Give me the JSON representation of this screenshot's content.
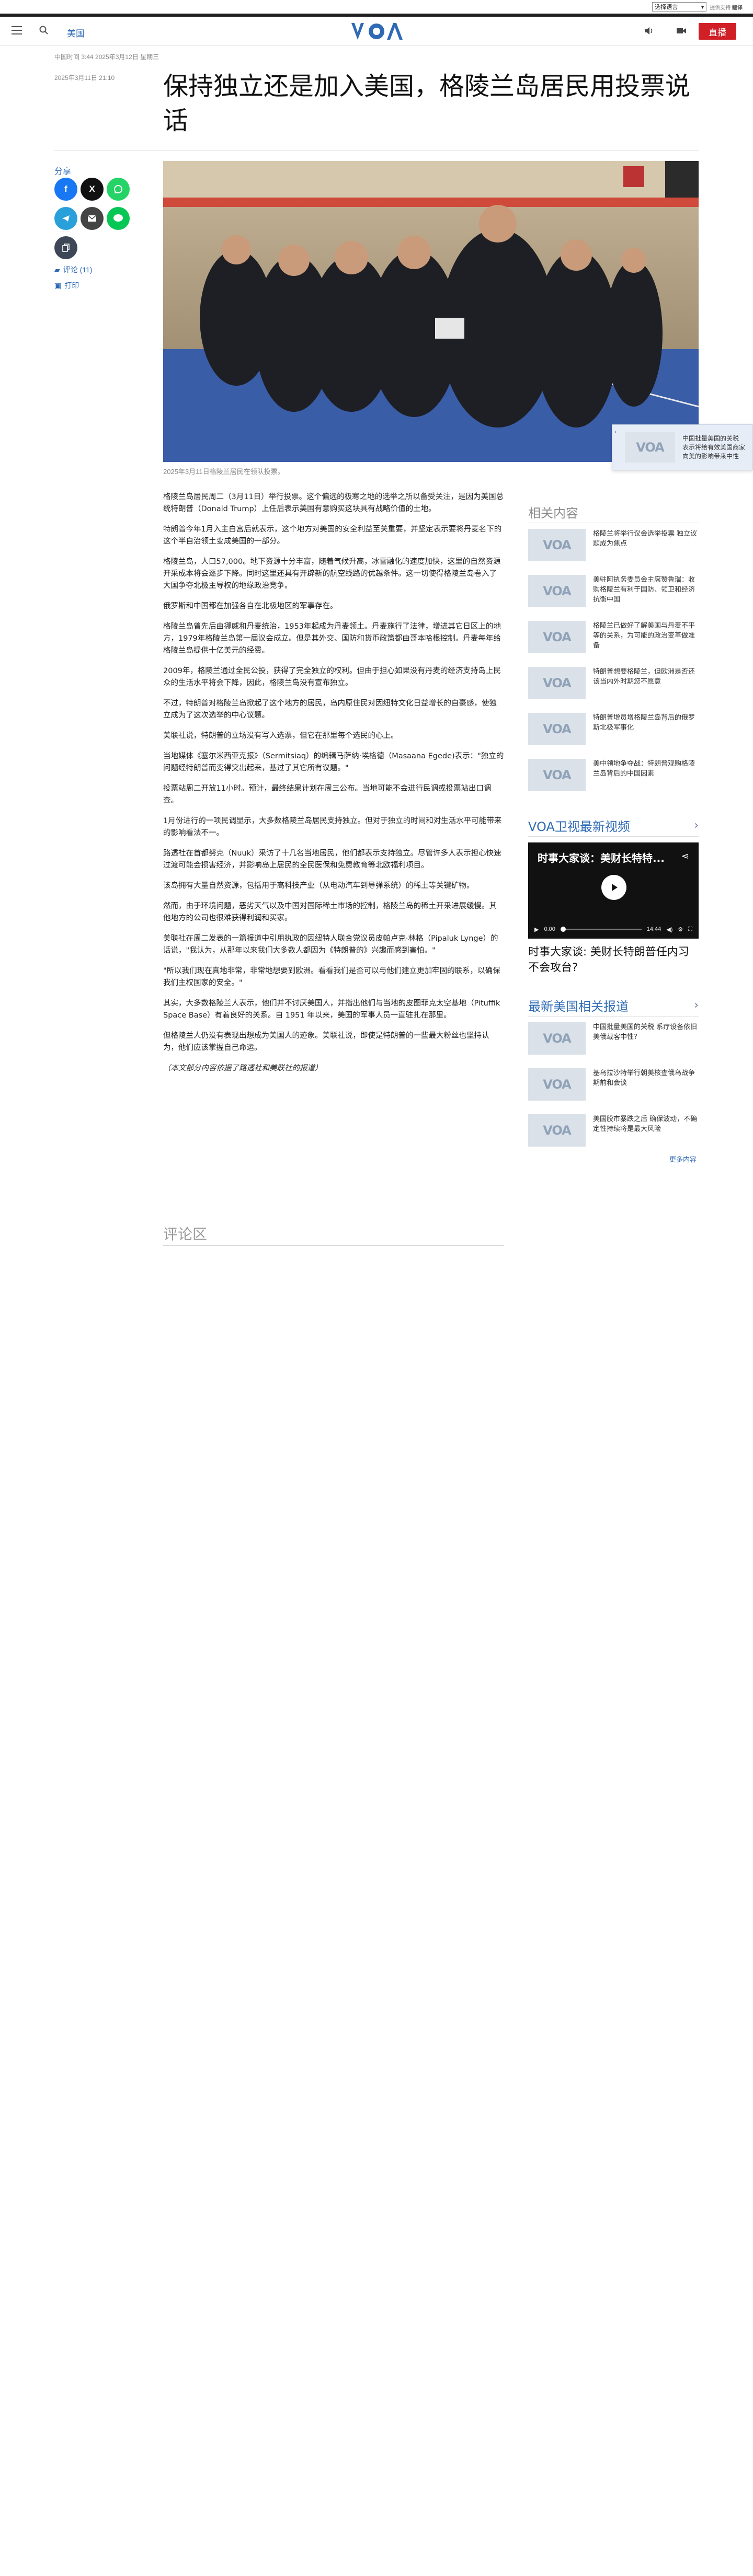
{
  "translate": {
    "select_label": "选择语言",
    "powered_prefix": "提供支持",
    "powered_brand": "翻译"
  },
  "header": {
    "section": "美国",
    "live_label": "直播"
  },
  "meta": {
    "timeline": "中国时间 3:44 2025年3月12日 星期三",
    "date": "2025年3月11日 21:10"
  },
  "article": {
    "title": "保持独立还是加入美国，格陵兰岛居民用投票说话",
    "caption": "2025年3月11日格陵兰居民在领队投票。",
    "paragraphs": [
      "格陵兰岛居民周二（3月11日）举行投票。这个偏远的极寒之地的选举之所以备受关注，是因为美国总统特朗普（Donald Trump）上任后表示美国有意购买这块具有战略价值的土地。",
      "特朗普今年1月入主白宫后就表示，这个地方对美国的安全利益至关重要，并坚定表示要将丹麦名下的这个半自治领土变成美国的一部分。",
      "格陵兰岛，人口57,000。地下资源十分丰富，随着气候升高，冰雪融化的速度加快，这里的自然资源开采成本将会逐步下降。同时这里还具有开辟新的航空线路的优越条件。这一切使得格陵兰岛卷入了大国争夺北极主导权的地缘政治竞争。",
      "俄罗斯和中国都在加强各自在北极地区的军事存在。",
      "格陵兰岛曾先后由挪威和丹麦统治，1953年起成为丹麦领土。丹麦施行了法律，增进其它日区上的地方，1979年格陵兰岛第一届议会成立。但是其外交、国防和货币政策都由哥本哈根控制。丹麦每年给格陵兰岛提供十亿美元的经费。",
      "2009年，格陵兰通过全民公投，获得了完全独立的权利。但由于担心如果没有丹麦的经济支持岛上民众的生活水平将会下降，因此，格陵兰岛没有宣布独立。",
      "不过，特朗普对格陵兰岛掀起了这个地方的居民，岛内原住民对因纽特文化日益增长的自豪感，使独立成为了这次选举的中心议题。",
      "美联社说，特朗普的立场没有写入选票，但它在那里每个选民的心上。",
      "当地媒体《塞尔米西亚克报》（Sermitsiaq）的编辑马萨纳·埃格德（Masaana Egede)表示：\"独立的问题经特朗普而变得突出起来，基过了其它所有议题。\"",
      "投票站周二开放11小时。预计，最终结果计划在周三公布。当地可能不会进行民调或投票站出口调查。",
      "1月份进行的一项民调显示，大多数格陵兰岛居民支持独立。但对于独立的时间和对生活水平可能带来的影响看法不一。",
      "路透社在首都努克（Nuuk）采访了十几名当地居民，他们都表示支持独立。尽管许多人表示担心快速过渡可能会损害经济，并影响岛上居民的全民医保和免费教育等北欧福利项目。",
      "该岛拥有大量自然资源，包括用于高科技产业（从电动汽车到导弹系统）的稀土等关键矿物。",
      "然而，由于环境问题，恶劣天气以及中国对国际稀土市场的控制，格陵兰岛的稀土开采进展缓慢。其他地方的公司也很难获得利润和买家。",
      "美联社在周二发表的一篇报道中引用执政的因纽特人联合党议员皮帕卢克·林格（Pipaluk Lynge）的话说，\"我认为，从那年以来我们大多数人都因为《特朗普的》兴趣而感到害怕。\"",
      "\"所以我们现在真地非常，非常地想要到欧洲。看看我们是否可以与他们建立更加牢固的联系，以确保我们主权国家的安全。\"",
      "其实，大多数格陵兰人表示，他们并不讨厌美国人，并指出他们与当地的皮图菲克太空基地（Pituffik Space Base）有着良好的关系。自 1951 年以来，美国的军事人员一直驻扎在那里。",
      "但格陵兰人仍没有表现出想成为美国人的迹象。美联社说，即使是特朗普的一些最大粉丝也坚持认为，他们应该掌握自己命运。"
    ],
    "note": "（本文部分内容依据了路透社和美联社的报道）",
    "comments_title": "评论区"
  },
  "share": {
    "label": "分享",
    "comments_link": "评论 (11)",
    "print_link": "打印"
  },
  "float_card": {
    "text": "中国批量美国的关税 表示将给有效美国商家向美的影响带来中性"
  },
  "related": {
    "heading": "相关内容",
    "items": [
      {
        "text": "格陵兰将举行议会选举投票 独立议题成为焦点"
      },
      {
        "text": "美驻阿执务委员会主席赞鲁瑞：收购格陵兰有利于国防、领卫和经济 抗衡中国"
      },
      {
        "text": "格陵兰已做好了解美国与丹麦不平等的关系，为可能的政治变革做准备"
      },
      {
        "text": "特朗普想要格陵兰，但欧洲是否还 该当内外时期您不愿意"
      },
      {
        "text": "特朗普增员增格陵兰岛背后的俄罗斯北极军事化"
      },
      {
        "text": "美中领地争夺战：特朗普观购格陵兰岛背后的中国因素"
      }
    ]
  },
  "video": {
    "heading": "VOA卫视最新视频",
    "overlay_title": "时事大家谈：美财长特特...",
    "time_current": "0:00",
    "time_total": "14:44",
    "caption": "时事大家谈: 美财长特朗普任内习不会攻台?"
  },
  "latest": {
    "heading": "最新美国相关报道",
    "items": [
      {
        "text": "中国批量美国的关税 系疗设备依旧美俄载客中性?"
      },
      {
        "text": "基乌拉沙特举行朝美核查俄乌战争期前和会谈"
      },
      {
        "text": "美国股市暴跌之后 确保波动，不确定性持续将是最大风险"
      }
    ],
    "more_label": "更多内容"
  }
}
